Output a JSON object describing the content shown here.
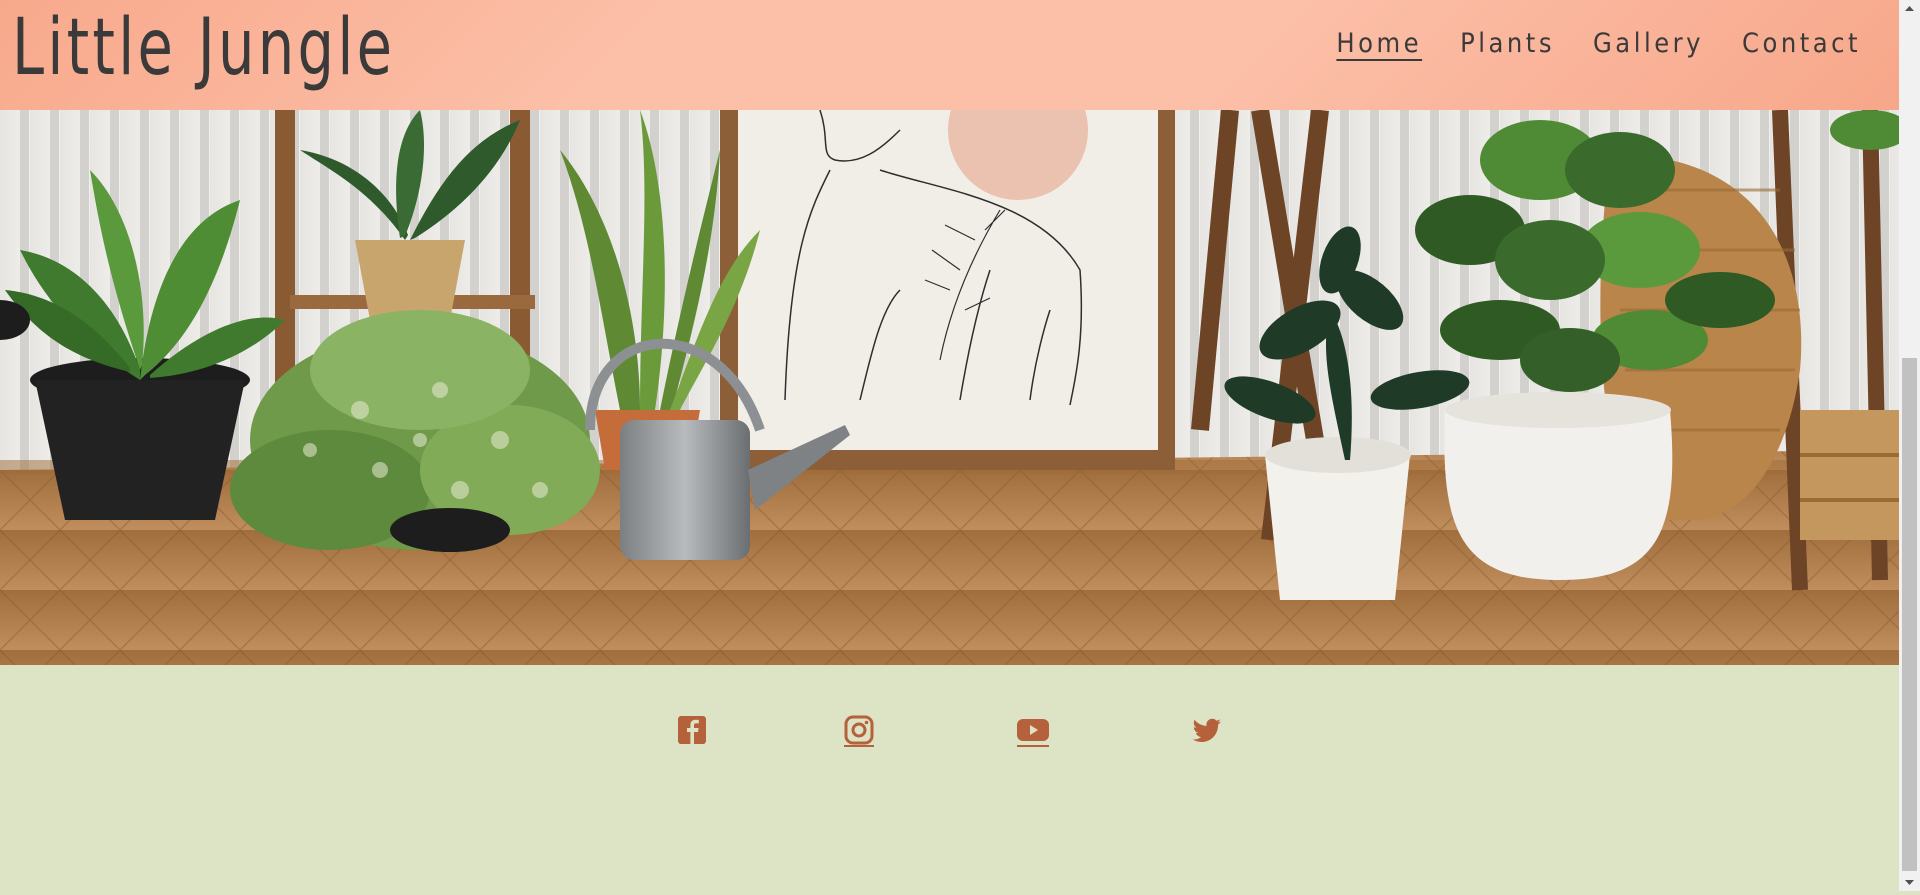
{
  "header": {
    "logo": "Little Jungle",
    "nav": [
      {
        "label": "Home",
        "active": true
      },
      {
        "label": "Plants",
        "active": false
      },
      {
        "label": "Gallery",
        "active": false
      },
      {
        "label": "Contact",
        "active": false
      }
    ]
  },
  "hero": {
    "scene": "indoor plants, watering can and line-art print on wooden floor"
  },
  "footer": {
    "social": [
      {
        "icon": "facebook-icon"
      },
      {
        "icon": "instagram-icon"
      },
      {
        "icon": "youtube-icon"
      },
      {
        "icon": "twitter-icon"
      }
    ]
  },
  "colors": {
    "header_gradient": [
      "#f8a98c",
      "#fcc0a9"
    ],
    "footer_bg": "#dde4c5",
    "icon": "#b5613b",
    "text": "#3a3a3a"
  }
}
